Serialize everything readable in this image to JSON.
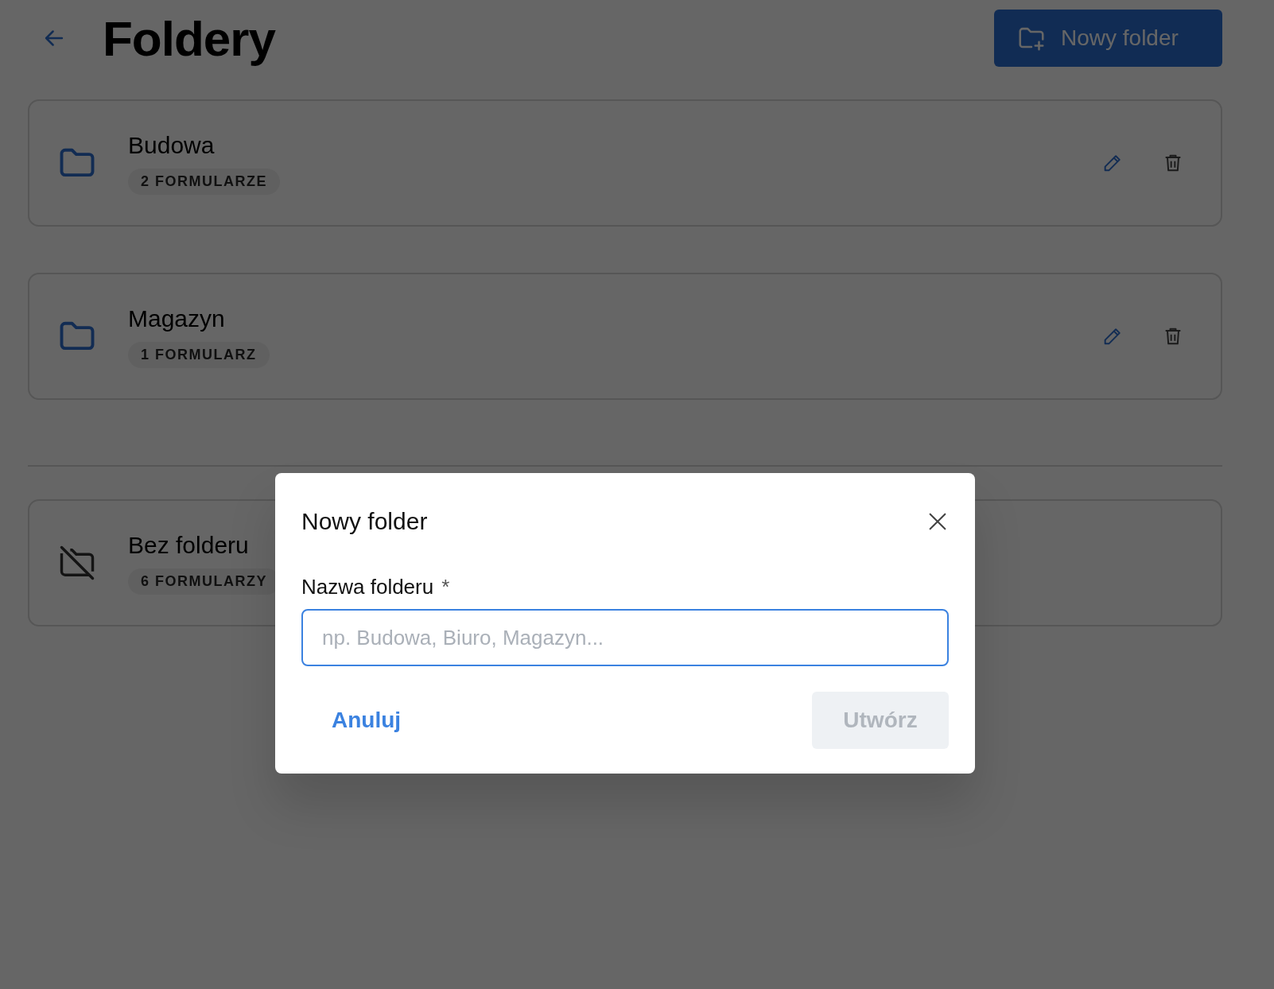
{
  "header": {
    "title": "Foldery",
    "new_button": "Nowy folder"
  },
  "folders": [
    {
      "kind": "folder",
      "name": "Budowa",
      "count": "2 FORMULARZE"
    },
    {
      "kind": "folder",
      "name": "Magazyn",
      "count": "1 FORMULARZ"
    }
  ],
  "unfiled": [
    {
      "kind": "none",
      "name": "Bez folderu",
      "count": "6 FORMULARZY"
    }
  ],
  "dialog": {
    "title": "Nowy folder",
    "field_label": "Nazwa folderu",
    "required_mark": "*",
    "placeholder": "np. Budowa, Biuro, Magazyn...",
    "focused": true,
    "cancel": "Anuluj",
    "submit": {
      "label": "Utwórz",
      "disabled": true
    }
  }
}
